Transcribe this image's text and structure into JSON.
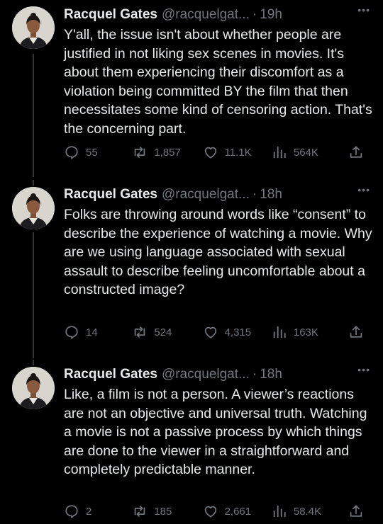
{
  "tweets": [
    {
      "name": "Racquel Gates",
      "handle": "@racquelgat...",
      "separator": "·",
      "time": "19h",
      "more": "•••",
      "text": "Y'all, the issue isn't about whether people are justified in not liking sex scenes in movies. It's about them experiencing their discomfort as a violation being committed BY the film that then necessitates some kind of censoring action. That's the concerning part.",
      "replies": "55",
      "retweets": "1,857",
      "likes": "11.1K",
      "views": "564K"
    },
    {
      "name": "Racquel Gates",
      "handle": "@racquelgat...",
      "separator": "·",
      "time": "18h",
      "more": "•••",
      "text": "Folks are throwing around words like “consent” to describe the experience of watching a movie. Why are we using language associated with sexual assault to describe feeling uncomfortable about a constructed image?",
      "replies": "14",
      "retweets": "524",
      "likes": "4,315",
      "views": "163K"
    },
    {
      "name": "Racquel Gates",
      "handle": "@racquelgat...",
      "separator": "·",
      "time": "18h",
      "more": "•••",
      "text": "Like, a film is not a person. A viewer’s reactions are not an objective and universal truth. Watching a movie is not a passive process by which things are done to the viewer in a straightforward and completely predictable manner.",
      "replies": "2",
      "retweets": "185",
      "likes": "2,661",
      "views": "58.4K"
    }
  ],
  "icons": {
    "reply": "reply-icon",
    "retweet": "retweet-icon",
    "like": "heart-icon",
    "views": "views-icon",
    "share": "share-icon"
  },
  "colors": {
    "background": "#000000",
    "text": "#e7e9ea",
    "muted": "#71767b",
    "thread_line": "#333639"
  }
}
